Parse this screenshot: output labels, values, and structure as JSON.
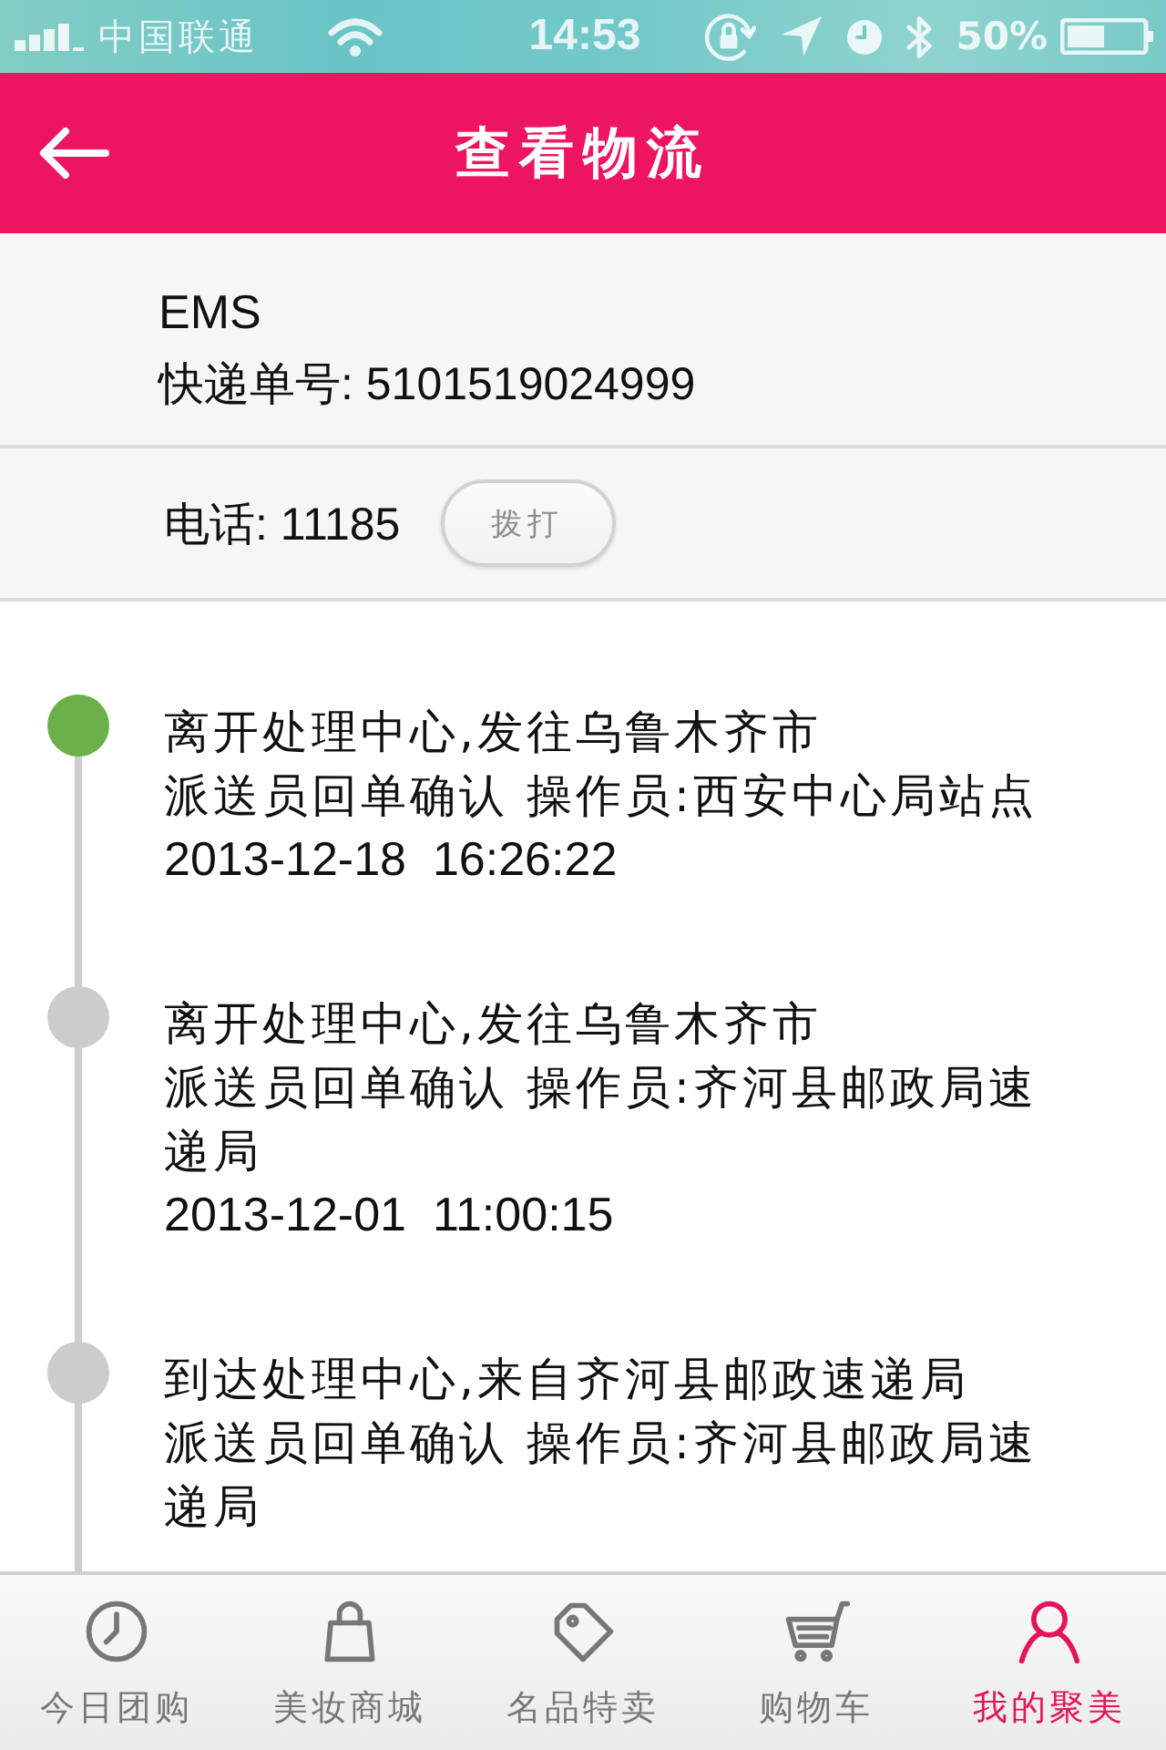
{
  "status_bar": {
    "carrier": "中国联通",
    "time": "14:53",
    "battery": "50%"
  },
  "header": {
    "title": "查看物流"
  },
  "shipment": {
    "courier": "EMS",
    "tracking": "快递单号: 5101519024999"
  },
  "contact": {
    "phone": "电话: 11185",
    "call_button": "拨打"
  },
  "timeline": [
    {
      "title": "离开处理中心,发往乌鲁木齐市",
      "detail": "派送员回单确认 操作员:西安中心局站点",
      "time": "2013-12-18  16:26:22",
      "color": "#6cb049"
    },
    {
      "title": "离开处理中心,发往乌鲁木齐市",
      "detail": "派送员回单确认 操作员:齐河县邮政局速递局",
      "time": "2013-12-01  11:00:15",
      "color": "#cccccc"
    },
    {
      "title": "到达处理中心,来自齐河县邮政速递局",
      "detail": "派送员回单确认 操作员:齐河县邮政局速递局",
      "color": "#cccccc"
    }
  ],
  "tabs": [
    {
      "label": "今日团购",
      "selected": false
    },
    {
      "label": "美妆商城",
      "selected": false
    },
    {
      "label": "名品特卖",
      "selected": false
    },
    {
      "label": "购物车",
      "selected": false
    },
    {
      "label": "我的聚美",
      "selected": true
    }
  ]
}
